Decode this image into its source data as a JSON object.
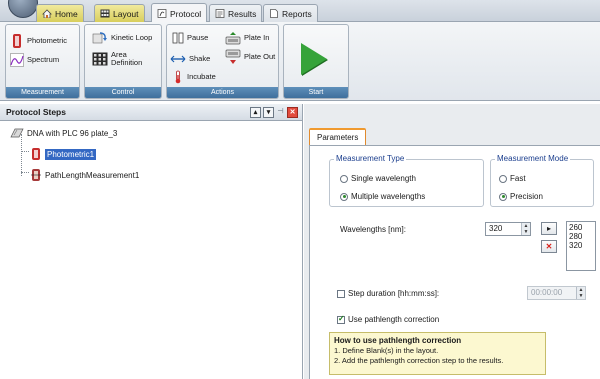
{
  "tabs": [
    {
      "label": "Home",
      "icon": "home-icon",
      "style": "colored"
    },
    {
      "label": "Layout",
      "icon": "grid-icon",
      "style": "colored"
    },
    {
      "label": "Protocol",
      "icon": "protocol-icon",
      "style": "active"
    },
    {
      "label": "Results",
      "icon": "results-icon",
      "style": "plain"
    },
    {
      "label": "Reports",
      "icon": "reports-icon",
      "style": "plain"
    }
  ],
  "ribbon": {
    "groups": {
      "measurement": {
        "label": "Measurement",
        "items": [
          "Photometric",
          "Spectrum"
        ]
      },
      "control": {
        "label": "Control",
        "items": [
          "Kinetic Loop",
          "Area\nDefinition"
        ]
      },
      "actions": {
        "label": "Actions",
        "items": [
          "Pause",
          "Shake",
          "Incubate",
          "Plate In",
          "Plate Out"
        ]
      },
      "start": {
        "label": "Start"
      }
    }
  },
  "steps": {
    "title": "Protocol Steps",
    "root": "DNA with PLC 96 plate_3",
    "children": [
      "Photometric1",
      "PathLengthMeasurement1"
    ],
    "selected": "Photometric1"
  },
  "params": {
    "tab": "Parameters",
    "measurement_type": {
      "legend": "Measurement Type",
      "options": [
        "Single wavelength",
        "Multiple wavelengths"
      ],
      "selected": "Multiple wavelengths"
    },
    "measurement_mode": {
      "legend": "Measurement Mode",
      "options": [
        "Fast",
        "Precision"
      ],
      "selected": "Precision"
    },
    "wavelengths": {
      "label": "Wavelengths [nm]:",
      "value": "320",
      "list": [
        "260",
        "280",
        "320"
      ],
      "add_glyph": "▸",
      "remove_glyph": "✕"
    },
    "step_duration": {
      "label": "Step duration [hh:mm:ss]:",
      "value": "00:00:00",
      "checked": false
    },
    "pathlength": {
      "label": "Use pathlength correction",
      "checked": true
    },
    "hint": {
      "title": "How to use pathlength correction",
      "lines": [
        "1. Define Blank(s) in the layout.",
        "2. Add the pathlength correction step to the results."
      ]
    }
  },
  "colors": {
    "accent_orange": "#f09a2f",
    "selection_blue": "#3468c3",
    "group_label_blue": "#4a7aa8",
    "start_green": "#36a33a"
  }
}
